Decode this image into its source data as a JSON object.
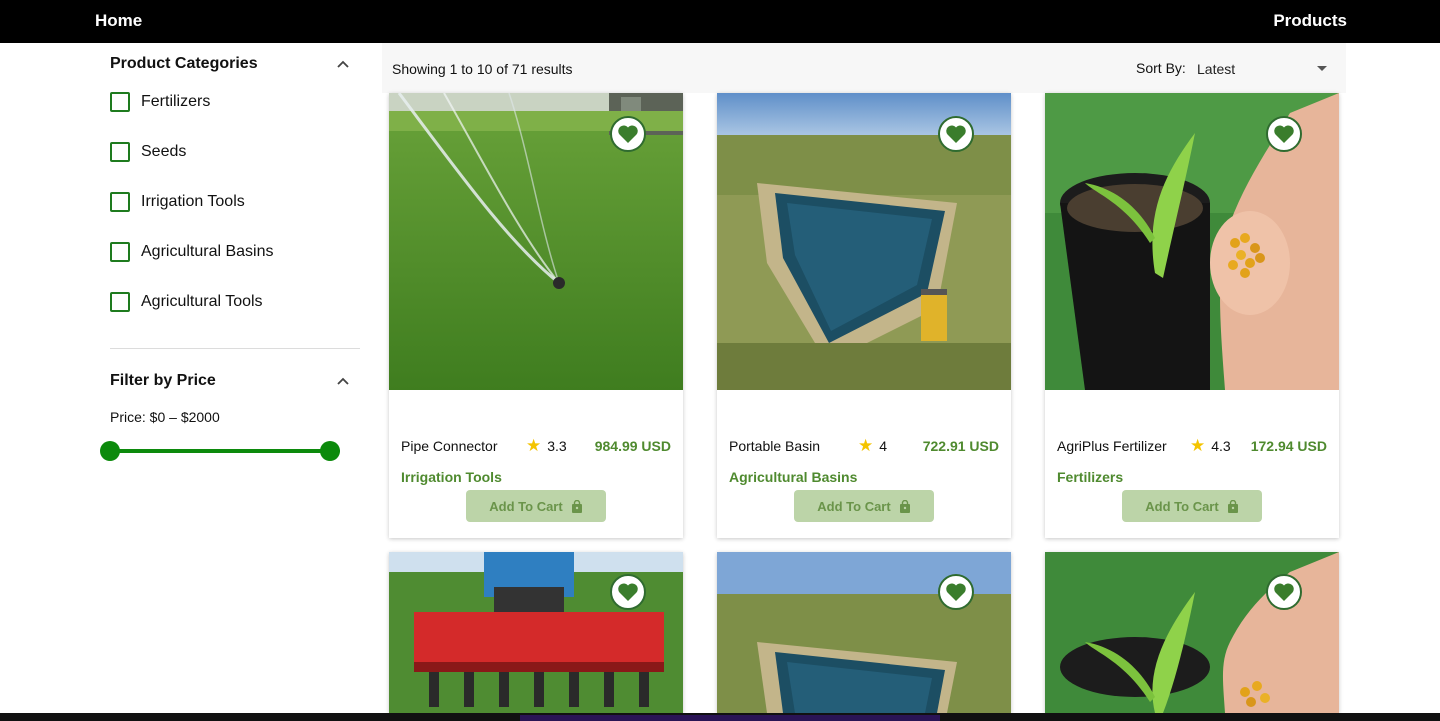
{
  "nav": {
    "home": "Home",
    "products": "Products"
  },
  "sidebar": {
    "categories_title": "Product Categories",
    "categories": [
      {
        "label": "Fertilizers",
        "checked": false
      },
      {
        "label": "Seeds",
        "checked": false
      },
      {
        "label": "Irrigation Tools",
        "checked": false
      },
      {
        "label": "Agricultural Basins",
        "checked": false
      },
      {
        "label": "Agricultural Tools",
        "checked": false
      }
    ],
    "price_title": "Filter by Price",
    "price_text": "Price: $0 – $2000",
    "price_range": {
      "min": 0,
      "max": 2000
    }
  },
  "toolbar": {
    "results_text": "Showing 1 to 10 of 71 results",
    "sort_label": "Sort By:",
    "sort_value": "Latest"
  },
  "products": [
    {
      "name": "Pipe Connector",
      "rating": "3.3",
      "price": "984.99 USD",
      "category": "Irrigation Tools",
      "cart_label": "Add To Cart",
      "image": "sprinkler"
    },
    {
      "name": "Portable Basin",
      "rating": "4",
      "price": "722.91 USD",
      "category": "Agricultural Basins",
      "cart_label": "Add To Cart",
      "image": "basin"
    },
    {
      "name": "AgriPlus Fertilizer",
      "rating": "4.3",
      "price": "172.94 USD",
      "category": "Fertilizers",
      "cart_label": "Add To Cart",
      "image": "fertilizer"
    },
    {
      "image": "seeder"
    },
    {
      "image": "basin"
    },
    {
      "image": "fertilizer"
    }
  ],
  "colors": {
    "brand_green": "#4f8a2f",
    "slider_green": "#0c8a0c",
    "checkbox_green": "#1e7b1e",
    "star": "#f4c400",
    "cart_button_bg": "#bcd4a8"
  },
  "icons": [
    "chevron-up-icon",
    "heart-icon",
    "star-icon",
    "shopping-bag-icon",
    "caret-down-icon"
  ]
}
